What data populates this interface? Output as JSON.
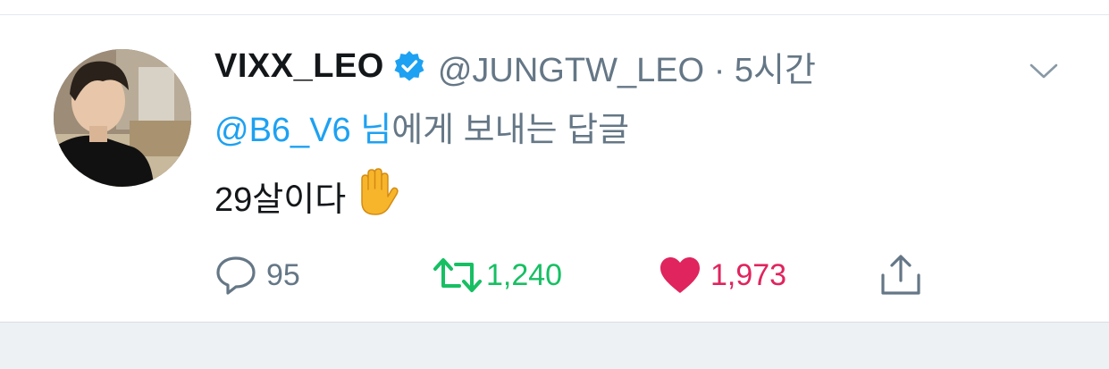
{
  "tweet": {
    "display_name": "VIXX_LEO",
    "handle": "@JUNGTW_LEO",
    "separator": "·",
    "time": "5시간",
    "reply_to": {
      "mention": "@B6_V6 님",
      "rest": "에게 보내는 답글"
    },
    "text": "29살이다",
    "emoji": "raised-hand-emoji",
    "actions": {
      "reply_count": "95",
      "retweet_count": "1,240",
      "like_count": "1,973"
    }
  },
  "colors": {
    "link": "#1da1f2",
    "secondary": "#657786",
    "retweet": "#17bf63",
    "like": "#e0245e",
    "verified": "#1da1f2"
  },
  "icons": [
    "verified-badge-icon",
    "chevron-down-icon",
    "reply-icon",
    "retweet-icon",
    "heart-icon",
    "share-icon"
  ]
}
